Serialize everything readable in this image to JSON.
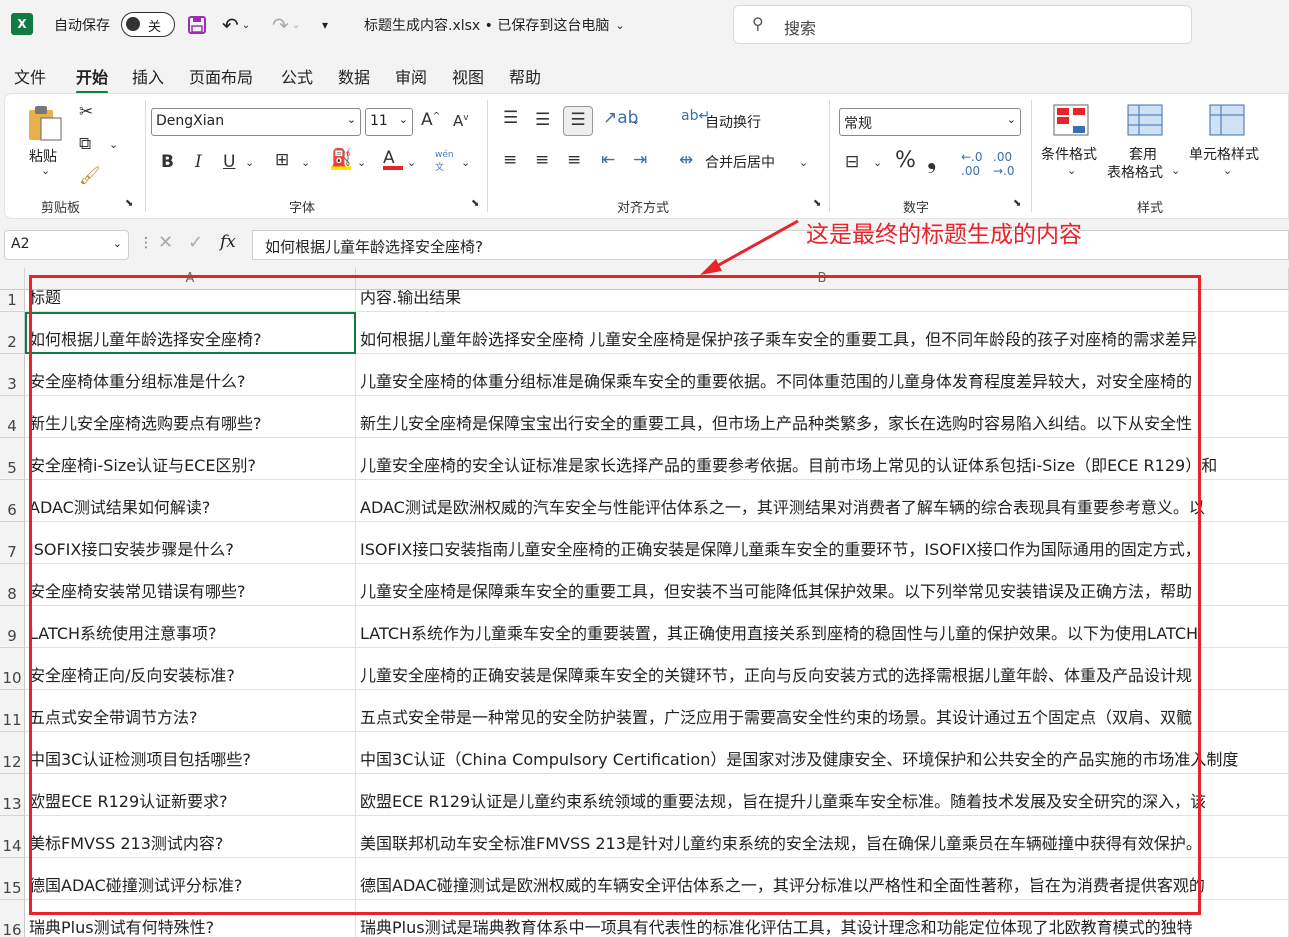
{
  "titlebar": {
    "app_icon": "X",
    "autosave_label": "自动保存",
    "autosave_state": "关",
    "file_title": "标题生成内容.xlsx • 已保存到这台电脑",
    "search_placeholder": "搜索"
  },
  "menu": {
    "items": [
      "文件",
      "开始",
      "插入",
      "页面布局",
      "公式",
      "数据",
      "审阅",
      "视图",
      "帮助"
    ],
    "active": "开始"
  },
  "ribbon": {
    "clipboard": {
      "paste_label": "粘贴",
      "group_label": "剪贴板"
    },
    "font": {
      "font_name": "DengXian",
      "font_size": "11",
      "group_label": "字体",
      "phonetic_top": "wén",
      "phonetic_bottom": "文"
    },
    "alignment": {
      "wrap_label": "自动换行",
      "merge_label": "合并后居中",
      "group_label": "对齐方式"
    },
    "number": {
      "format_value": "常规",
      "percent": "%",
      "comma": "❟",
      "group_label": "数字"
    },
    "styles": {
      "conditional_label": "条件格式",
      "table_label_1": "套用",
      "table_label_2": "表格格式",
      "cell_styles_label": "单元格样式",
      "group_label": "样式"
    }
  },
  "formula_bar": {
    "name_box": "A2",
    "fx": "fx",
    "content": "如何根据儿童年龄选择安全座椅?"
  },
  "annotation": "这是最终的标题生成的内容",
  "sheet": {
    "columns": [
      "A",
      "B"
    ],
    "row_numbers": [
      "1",
      "2",
      "3",
      "4",
      "5",
      "6",
      "7",
      "8",
      "9",
      "10",
      "11",
      "12",
      "13",
      "14",
      "15",
      "16"
    ],
    "header_row": {
      "a": "标题",
      "b": "内容.输出结果"
    },
    "rows": [
      {
        "a": "如何根据儿童年龄选择安全座椅?",
        "b": "如何根据儿童年龄选择安全座椅  儿童安全座椅是保护孩子乘车安全的重要工具，但不同年龄段的孩子对座椅的需求差异"
      },
      {
        "a": "安全座椅体重分组标准是什么?",
        "b": "儿童安全座椅的体重分组标准是确保乘车安全的重要依据。不同体重范围的儿童身体发育程度差异较大，对安全座椅的"
      },
      {
        "a": "新生儿安全座椅选购要点有哪些?",
        "b": "新生儿安全座椅是保障宝宝出行安全的重要工具，但市场上产品种类繁多，家长在选购时容易陷入纠结。以下从安全性"
      },
      {
        "a": "安全座椅i-Size认证与ECE区别?",
        "b": "儿童安全座椅的安全认证标准是家长选择产品的重要参考依据。目前市场上常见的认证体系包括i-Size（即ECE R129）和"
      },
      {
        "a": "ADAC测试结果如何解读?",
        "b": "ADAC测试是欧洲权威的汽车安全与性能评估体系之一，其评测结果对消费者了解车辆的综合表现具有重要参考意义。以"
      },
      {
        "a": "ISOFIX接口安装步骤是什么?",
        "b": "ISOFIX接口安装指南儿童安全座椅的正确安装是保障儿童乘车安全的重要环节，ISOFIX接口作为国际通用的固定方式，"
      },
      {
        "a": "安全座椅安装常见错误有哪些?",
        "b": "儿童安全座椅是保障乘车安全的重要工具，但安装不当可能降低其保护效果。以下列举常见安装错误及正确方法，帮助"
      },
      {
        "a": "LATCH系统使用注意事项?",
        "b": "LATCH系统作为儿童乘车安全的重要装置，其正确使用直接关系到座椅的稳固性与儿童的保护效果。以下为使用LATCH"
      },
      {
        "a": "安全座椅正向/反向安装标准?",
        "b": "儿童安全座椅的正确安装是保障乘车安全的关键环节，正向与反向安装方式的选择需根据儿童年龄、体重及产品设计规"
      },
      {
        "a": "五点式安全带调节方法?",
        "b": "五点式安全带是一种常见的安全防护装置，广泛应用于需要高安全性约束的场景。其设计通过五个固定点（双肩、双髋"
      },
      {
        "a": "中国3C认证检测项目包括哪些?",
        "b": "中国3C认证（China Compulsory Certification）是国家对涉及健康安全、环境保护和公共安全的产品实施的市场准入制度"
      },
      {
        "a": "欧盟ECE R129认证新要求?",
        "b": "欧盟ECE R129认证是儿童约束系统领域的重要法规，旨在提升儿童乘车安全标准。随着技术发展及安全研究的深入，该"
      },
      {
        "a": "美标FMVSS 213测试内容?",
        "b": "美国联邦机动车安全标准FMVSS 213是针对儿童约束系统的安全法规，旨在确保儿童乘员在车辆碰撞中获得有效保护。"
      },
      {
        "a": "德国ADAC碰撞测试评分标准?",
        "b": "德国ADAC碰撞测试是欧洲权威的车辆安全评估体系之一，其评分标准以严格性和全面性著称，旨在为消费者提供客观的"
      },
      {
        "a": "瑞典Plus测试有何特殊性?",
        "b": "瑞典Plus测试是瑞典教育体系中一项具有代表性的标准化评估工具，其设计理念和功能定位体现了北欧教育模式的独特"
      }
    ]
  },
  "colors": {
    "accent": "#107c41",
    "annotation_red": "#e8232a"
  }
}
